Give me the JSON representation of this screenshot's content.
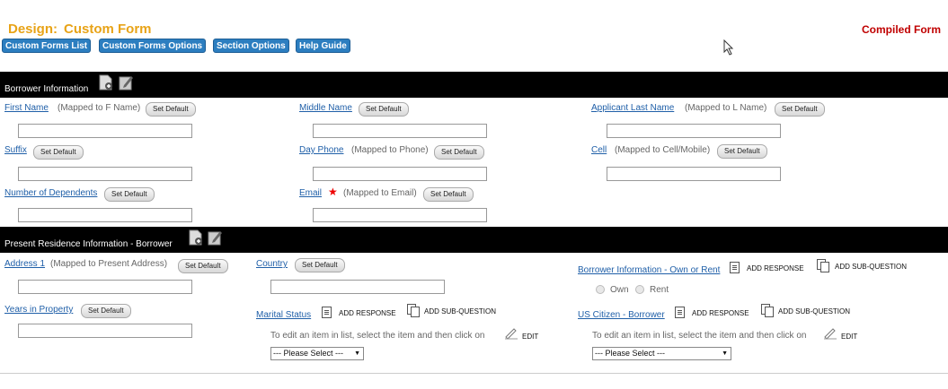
{
  "header": {
    "title_prefix": "Design:",
    "title_name": "Custom Form",
    "compiled_label": "Compiled Form",
    "buttons": [
      "Custom Forms List",
      "Custom Forms Options",
      "Section Options",
      "Help Guide"
    ]
  },
  "common": {
    "set_default": "Set Default",
    "add_response": "ADD RESPONSE",
    "add_subquestion": "ADD SUB-QUESTION",
    "edit_hint": "To edit an item in list, select the item and then click on",
    "edit_label": "EDIT",
    "please_select": "--- Please Select ---",
    "please_select_b": "--- Please Select ---"
  },
  "section1": {
    "title": "Borrower Information",
    "fields": {
      "first_name": "First Name",
      "first_name_map": "(Mapped to F Name)",
      "middle_name": "Middle Name",
      "last_name": "Applicant Last Name",
      "last_name_map": "(Mapped to L Name)",
      "suffix": "Suffix",
      "day_phone": "Day Phone",
      "day_phone_map": "(Mapped to Phone)",
      "cell": "Cell",
      "cell_map": "(Mapped to Cell/Mobile)",
      "dependents": "Number of Dependents",
      "email": "Email",
      "email_map": "(Mapped to Email)"
    }
  },
  "section2": {
    "title": "Present Residence Information - Borrower",
    "fields": {
      "address1": "Address 1",
      "address1_map": "(Mapped to Present Address)",
      "country": "Country",
      "own_rent": "Borrower Information - Own or Rent",
      "own": "Own",
      "rent": "Rent",
      "years": "Years in Property",
      "marital": "Marital Status",
      "citizen": "US Citizen - Borrower"
    }
  },
  "colors": {
    "accent": "#e8a317",
    "button": "#2c7ec0",
    "compiled": "#c00000",
    "link": "#1f5fa8"
  }
}
